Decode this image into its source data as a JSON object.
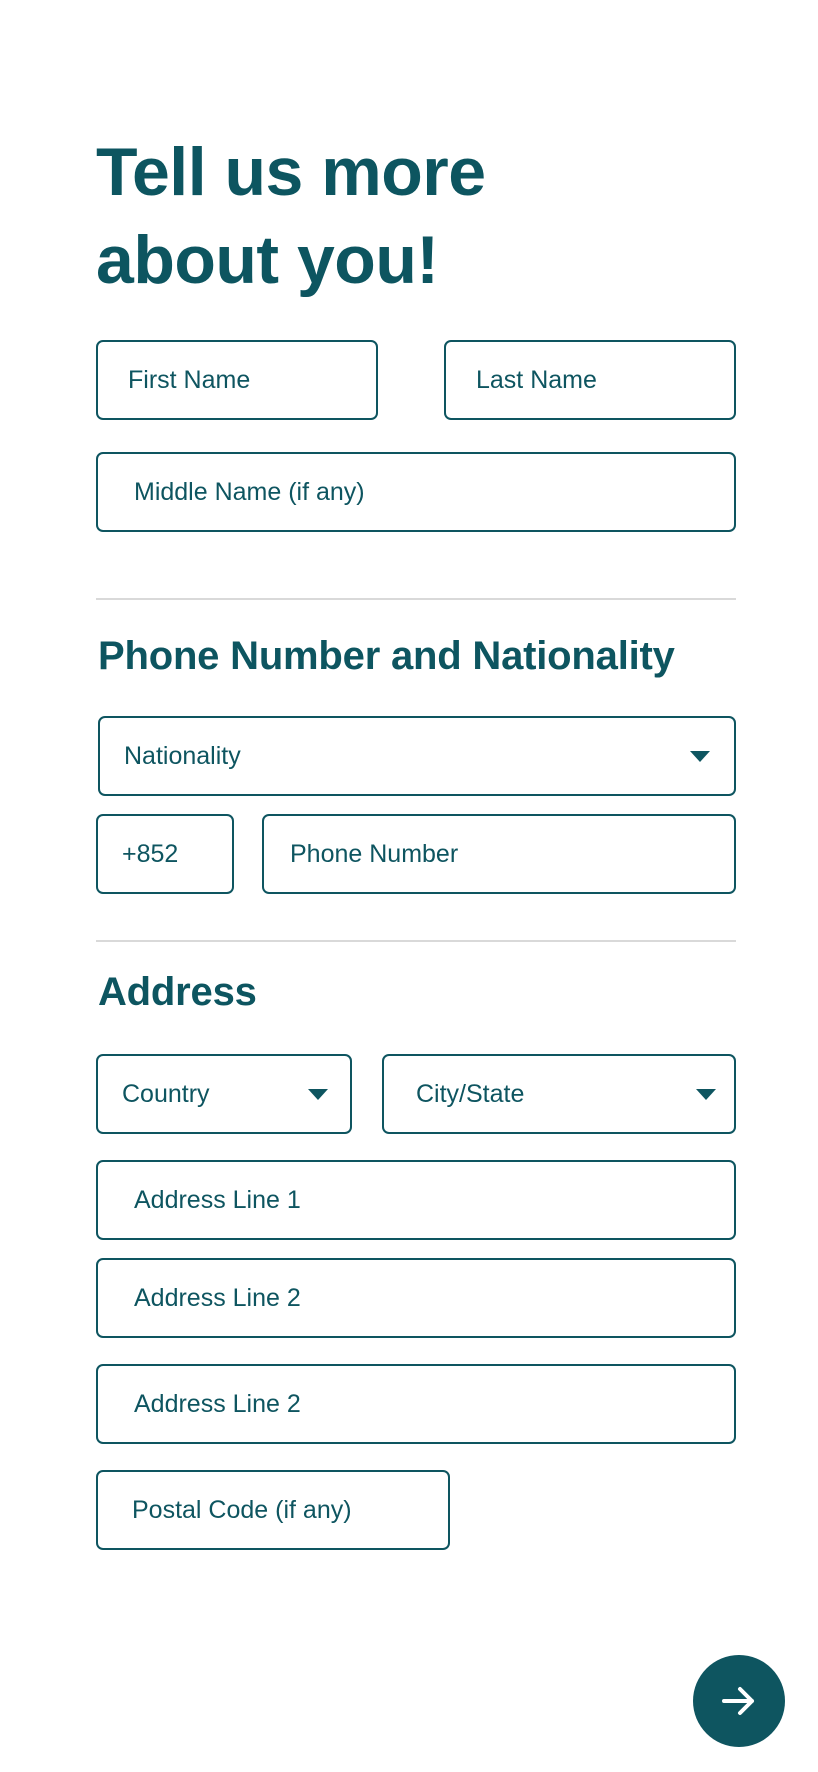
{
  "header": {
    "title_line1": "Tell us more",
    "title_line2": "about you!"
  },
  "name": {
    "first_name_placeholder": "First Name",
    "last_name_placeholder": "Last Name",
    "middle_name_placeholder": "Middle Name (if any)"
  },
  "phone_section": {
    "title": "Phone Number and Nationality",
    "nationality_select": "Nationality",
    "country_code": "+852",
    "phone_placeholder": "Phone Number"
  },
  "address_section": {
    "title": "Address",
    "country_select": "Country",
    "city_state_select": "City/State",
    "address_line1_placeholder": "Address Line 1",
    "address_line2_placeholder": "Address Line 2",
    "address_line3_placeholder": "Address Line 2",
    "postal_code_placeholder": "Postal Code (if any)"
  },
  "next_button": {
    "icon": "arrow-right-icon"
  },
  "colors": {
    "primary": "#0e5560",
    "divider": "#d9d9d9",
    "background": "#ffffff"
  }
}
